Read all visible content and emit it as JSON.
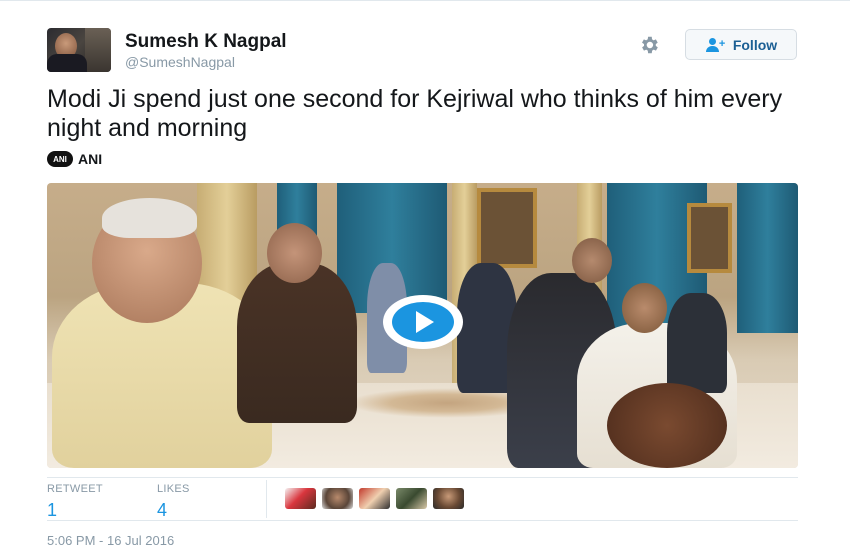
{
  "user": {
    "name": "Sumesh K Nagpal",
    "handle": "@SumeshNagpal",
    "avatar_icon": "profile-photo"
  },
  "header": {
    "settings_icon": "gear-icon",
    "follow_label": "Follow",
    "follow_icon": "follow-person-plus-icon"
  },
  "tweet": {
    "text": "Modi Ji spend just one second for Kejriwal who thinks of him every night and morning"
  },
  "source": {
    "logo_icon": "ani-logo",
    "name": "ANI"
  },
  "media": {
    "type": "video",
    "play_icon": "play-icon"
  },
  "stats": {
    "retweets_label": "RETWEET",
    "retweets_count": "1",
    "likes_label": "LIKES",
    "likes_count": "4"
  },
  "likers": [
    {
      "icon": "liker-avatar-1"
    },
    {
      "icon": "liker-avatar-2"
    },
    {
      "icon": "liker-avatar-3"
    },
    {
      "icon": "liker-avatar-4"
    },
    {
      "icon": "liker-avatar-5"
    }
  ],
  "timestamp": "5:06 PM - 16 Jul 2016",
  "colors": {
    "accent": "#1b95e0",
    "text": "#14171a",
    "muted": "#8899a6",
    "border": "#e1e8ed"
  }
}
